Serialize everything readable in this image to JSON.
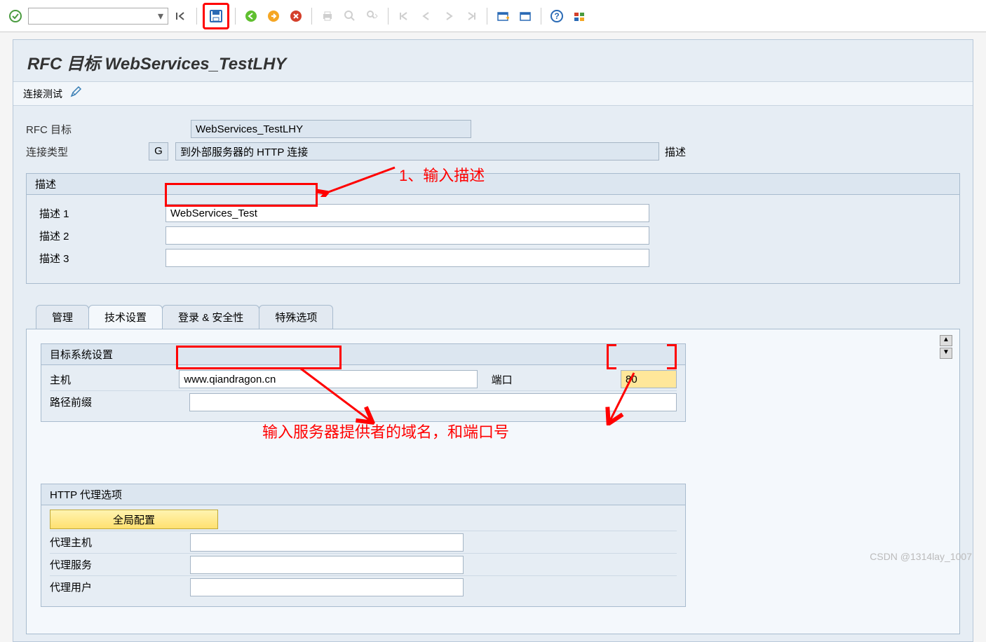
{
  "toolbar": {
    "combo_value": ""
  },
  "page": {
    "title": "RFC 目标 WebServices_TestLHY",
    "test_conn_label": "连接测试"
  },
  "form": {
    "rfc_label": "RFC 目标",
    "rfc_value": "WebServices_TestLHY",
    "conn_type_label": "连接类型",
    "conn_type_code": "G",
    "conn_type_desc": "到外部服务器的 HTTP 连接",
    "desc_trail": "描述"
  },
  "desc_group": {
    "title": "描述",
    "rows": [
      {
        "label": "描述 1",
        "value": "WebServices_Test"
      },
      {
        "label": "描述 2",
        "value": ""
      },
      {
        "label": "描述 3",
        "value": ""
      }
    ]
  },
  "tabs": [
    {
      "id": "admin",
      "label": "管理"
    },
    {
      "id": "tech",
      "label": "技术设置"
    },
    {
      "id": "login",
      "label": "登录 & 安全性"
    },
    {
      "id": "special",
      "label": "特殊选项"
    }
  ],
  "active_tab": "tech",
  "target_section": {
    "title": "目标系统设置",
    "host_label": "主机",
    "host_value": "www.qiandragon.cn",
    "port_label": "端口",
    "port_value": "80",
    "path_label": "路径前缀",
    "path_value": ""
  },
  "proxy_section": {
    "title": "HTTP 代理选项",
    "global_btn": "全局配置",
    "rows": [
      {
        "label": "代理主机",
        "value": ""
      },
      {
        "label": "代理服务",
        "value": ""
      },
      {
        "label": "代理用户",
        "value": ""
      }
    ]
  },
  "annotations": {
    "ann1": "1、输入描述",
    "ann2": "输入服务器提供者的域名，和端口号"
  },
  "watermark": "CSDN @1314lay_1007"
}
